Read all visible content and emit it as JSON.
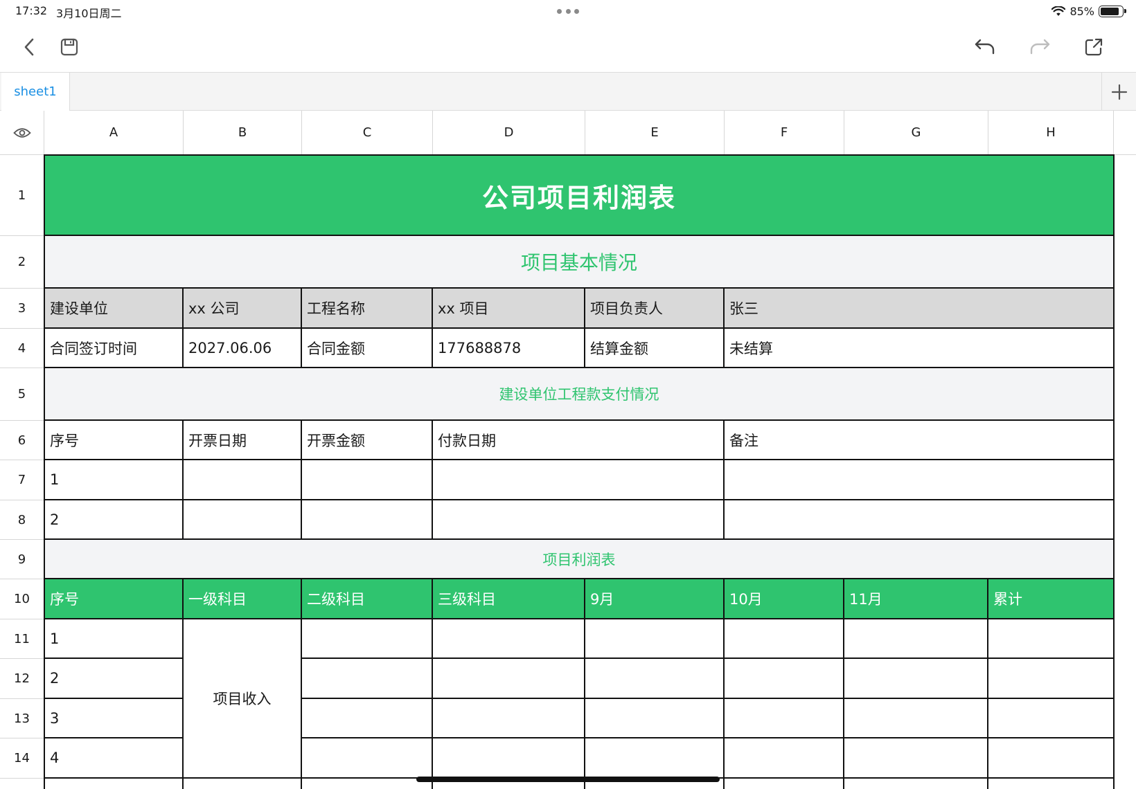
{
  "status_bar": {
    "time": "17:32",
    "date": "3月10日周二",
    "battery": "85%",
    "battery_level": 0.85
  },
  "toolbar": {
    "back_icon": "chevron-left-icon",
    "save_icon": "save-icon",
    "undo_icon": "undo-icon",
    "redo_icon": "redo-icon",
    "share_icon": "share-icon"
  },
  "sheets": {
    "active_tab": "sheet1",
    "add_icon": "plus-icon"
  },
  "colors": {
    "accent_green": "#2fc46f",
    "section_bg": "#f3f4f6",
    "header_gray": "#d9d9d9",
    "tab_blue": "#1a8fe3"
  },
  "grid": {
    "columns": [
      "A",
      "B",
      "C",
      "D",
      "E",
      "F",
      "G",
      "H"
    ],
    "rows": [
      "1",
      "2",
      "3",
      "4",
      "5",
      "6",
      "7",
      "8",
      "9",
      "10",
      "11",
      "12",
      "13",
      "14"
    ],
    "title": "公司项目利润表",
    "section_basic": "项目基本情况",
    "row3": {
      "a": "建设单位",
      "b": "xx 公司",
      "c": "工程名称",
      "d": "xx 项目",
      "e": "项目负责人",
      "f": "张三"
    },
    "row4": {
      "a": "合同签订时间",
      "b": "2027.06.06",
      "c": "合同金额",
      "d": "177688878",
      "e": "结算金额",
      "f": "未结算"
    },
    "section_payment": "建设单位工程款支付情况",
    "payment_headers": {
      "a": "序号",
      "b": "开票日期",
      "c": "开票金额",
      "d": "付款日期",
      "f": "备注"
    },
    "payment_rows": [
      "1",
      "2"
    ],
    "section_profit": "项目利润表",
    "profit_headers": [
      "序号",
      "一级科目",
      "二级科目",
      "三级科目",
      "9月",
      "10月",
      "11月",
      "累计"
    ],
    "profit_rows": [
      "1",
      "2",
      "3",
      "4"
    ],
    "profit_merged_b": "项目收入"
  }
}
